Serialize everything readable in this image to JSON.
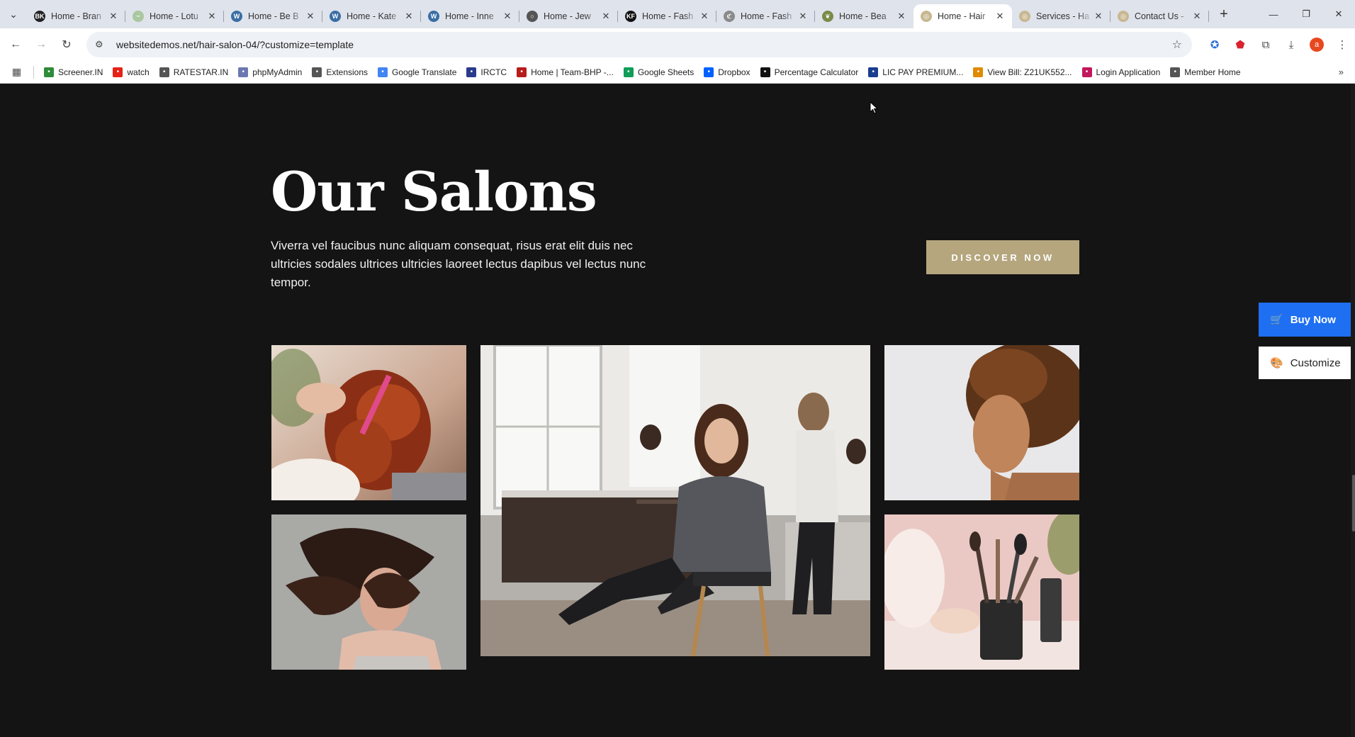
{
  "browser": {
    "tabs": [
      {
        "title": "Home - Bran",
        "fav_color": "#222222",
        "fav_glyph": "BK"
      },
      {
        "title": "Home - Lotu",
        "fav_color": "#a9c7a0",
        "fav_glyph": "~"
      },
      {
        "title": "Home - Be B",
        "fav_color": "#3a6ea5",
        "fav_glyph": "W"
      },
      {
        "title": "Home - Kate",
        "fav_color": "#3a6ea5",
        "fav_glyph": "W"
      },
      {
        "title": "Home - Inne",
        "fav_color": "#3a6ea5",
        "fav_glyph": "W"
      },
      {
        "title": "Home - Jew",
        "fav_color": "#555555",
        "fav_glyph": "○"
      },
      {
        "title": "Home - Fash",
        "fav_color": "#111111",
        "fav_glyph": "KF"
      },
      {
        "title": "Home - Fash",
        "fav_color": "#8a8a8a",
        "fav_glyph": "ℭ"
      },
      {
        "title": "Home - Bea",
        "fav_color": "#7a8b4a",
        "fav_glyph": "❦"
      },
      {
        "title": "Home - Hair",
        "fav_color": "#c8b792",
        "fav_glyph": "◎",
        "active": true
      },
      {
        "title": "Services - Ha",
        "fav_color": "#c8b792",
        "fav_glyph": "◎"
      },
      {
        "title": "Contact Us -",
        "fav_color": "#c8b792",
        "fav_glyph": "◎"
      }
    ],
    "url": "websitedemos.net/hair-salon-04/?customize=template",
    "profile_initial": "a",
    "bookmarks": [
      {
        "label": "Screener.IN",
        "icon": "bar-chart-icon",
        "color": "#2e8b3a"
      },
      {
        "label": "watch",
        "icon": "youtube-icon",
        "color": "#e62117"
      },
      {
        "label": "RATESTAR.IN",
        "icon": "ratestar-icon",
        "color": "#555555"
      },
      {
        "label": "phpMyAdmin",
        "icon": "phpmyadmin-icon",
        "color": "#6c78af"
      },
      {
        "label": "Extensions",
        "icon": "puzzle-icon",
        "color": "#555555"
      },
      {
        "label": "Google Translate",
        "icon": "translate-icon",
        "color": "#4285f4"
      },
      {
        "label": "IRCTC",
        "icon": "irctc-icon",
        "color": "#2b3a8c"
      },
      {
        "label": "Home | Team-BHP -...",
        "icon": "teambhp-icon",
        "color": "#b71c1c"
      },
      {
        "label": "Google Sheets",
        "icon": "sheets-icon",
        "color": "#0f9d58"
      },
      {
        "label": "Dropbox",
        "icon": "dropbox-icon",
        "color": "#0061ff"
      },
      {
        "label": "Percentage Calculator",
        "icon": "percent-icon",
        "color": "#111111"
      },
      {
        "label": "LIC PAY PREMIUM...",
        "icon": "lic-icon",
        "color": "#1a3d8f"
      },
      {
        "label": "View Bill: Z21UK552...",
        "icon": "bill-icon",
        "color": "#e08a00"
      },
      {
        "label": "Login Application",
        "icon": "login-icon",
        "color": "#c2185b"
      },
      {
        "label": "Member Home",
        "icon": "globe-icon",
        "color": "#555555"
      }
    ]
  },
  "section": {
    "title": "Our Salons",
    "description": "Viverra vel faucibus nunc aliquam consequat, risus erat elit duis nec ultricies sodales ultrices ultricies laoreet lectus dapibus vel lectus nunc tempor.",
    "cta_label": "DISCOVER NOW",
    "accent_color": "#b5a67e",
    "background_color": "#141414"
  },
  "floating": {
    "buy_label": "Buy Now",
    "customize_label": "Customize",
    "buy_color": "#1e6ff1"
  }
}
